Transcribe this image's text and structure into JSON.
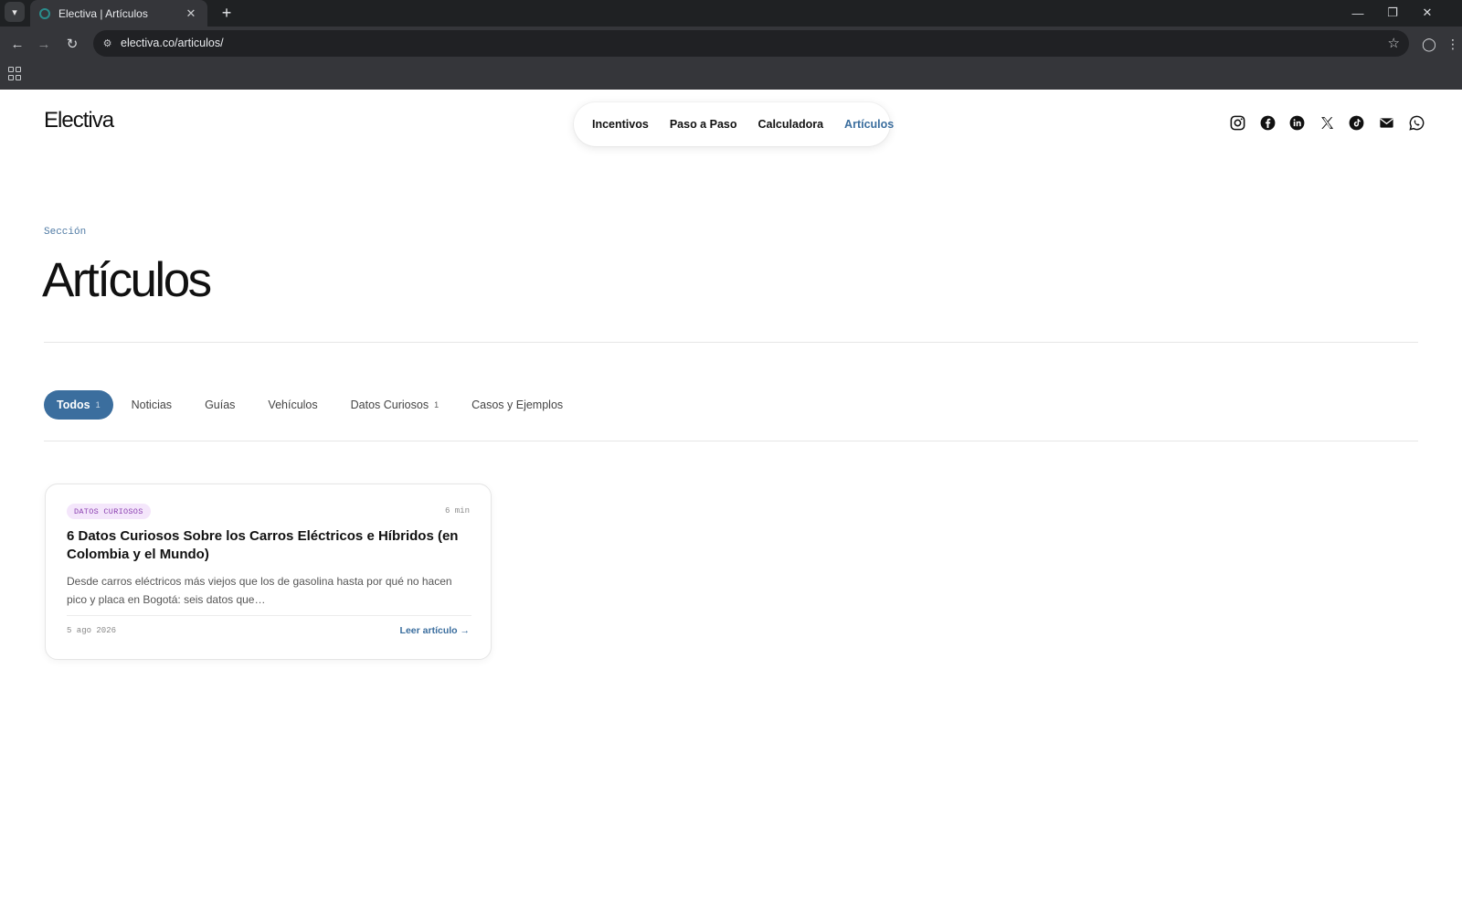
{
  "browser": {
    "tab_title": "Electiva | Artículos",
    "tab_close": "✕",
    "new_tab": "+",
    "url": "electiva.co/articulos/"
  },
  "site": {
    "logo": "Electiva",
    "nav": [
      {
        "label": "Incentivos",
        "active": false
      },
      {
        "label": "Paso a Paso",
        "active": false
      },
      {
        "label": "Calculadora",
        "active": false
      },
      {
        "label": "Artículos",
        "active": true
      }
    ],
    "socials": [
      "instagram-icon",
      "facebook-icon",
      "linkedin-icon",
      "x-icon",
      "tiktok-icon",
      "email-icon",
      "whatsapp-icon"
    ]
  },
  "header": {
    "section_label": "Sección",
    "title": "Artículos"
  },
  "filters": [
    {
      "label": "Todos",
      "count": "1",
      "active": true
    },
    {
      "label": "Noticias",
      "count": "",
      "active": false
    },
    {
      "label": "Guías",
      "count": "",
      "active": false
    },
    {
      "label": "Vehículos",
      "count": "",
      "active": false
    },
    {
      "label": "Datos Curiosos",
      "count": "1",
      "active": false
    },
    {
      "label": "Casos y Ejemplos",
      "count": "",
      "active": false
    }
  ],
  "articles": [
    {
      "tag": "DATOS CURIOSOS",
      "read_time": "6 min",
      "title": "6 Datos Curiosos Sobre los Carros Eléctricos e Híbridos (en Colombia y el Mundo)",
      "excerpt": "Desde carros eléctricos más viejos que los de gasolina hasta por qué no hacen pico y placa en Bogotá: seis datos que…",
      "date": "5 ago 2026",
      "link": "Leer artículo →"
    }
  ],
  "colors": {
    "accent": "#3b6e9e",
    "tag_bg": "#f4e6fb",
    "tag_text": "#8a3fb0"
  }
}
